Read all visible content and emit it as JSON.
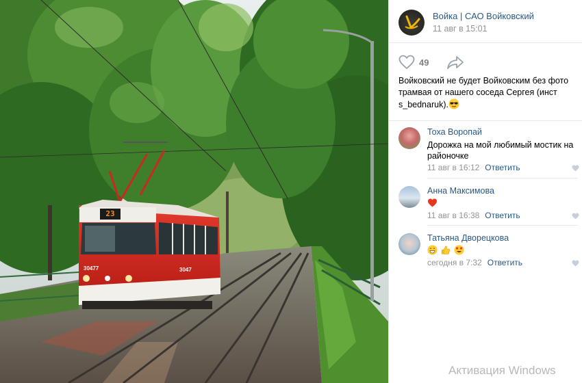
{
  "post": {
    "group_name": "Войка | САО Войковский",
    "date": "11 авг в 15:01",
    "likes": "49",
    "text": "Войковский не будет Войковским без фото трамвая от нашего соседа Сергея (инст s_bednaruk).",
    "text_emoji": "sunglasses-emoji"
  },
  "photo": {
    "tram_route": "23",
    "tram_number_left": "30477",
    "tram_number_side": "3047"
  },
  "comments": [
    {
      "author": "Тоха Воропай",
      "text": "Дорожка на мой любимый мостик на районочке",
      "date": "11 авг в 16:12",
      "reply": "Ответить"
    },
    {
      "author": "Анна Максимова",
      "text": "",
      "emojis": [
        "heart-emoji"
      ],
      "date": "11 авг в 16:38",
      "reply": "Ответить"
    },
    {
      "author": "Татьяна Дворецкова",
      "text": "",
      "emojis": [
        "grin-emoji",
        "thumbs-up-emoji",
        "heart-eyes-emoji"
      ],
      "date": "сегодня в 7:32",
      "reply": "Ответить"
    }
  ],
  "watermark": "Активация Windows",
  "colors": {
    "link": "#2a5885",
    "meta": "#939393",
    "tram_red": "#d8281f"
  }
}
